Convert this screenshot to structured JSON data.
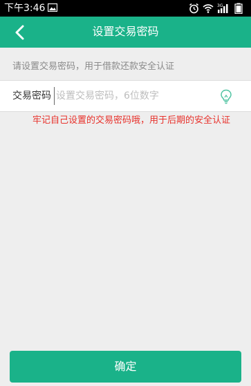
{
  "status_bar": {
    "time": "下午3:46",
    "icons": [
      "image-icon",
      "alarm-icon",
      "wifi-icon",
      "signal-icon",
      "battery-icon"
    ]
  },
  "app_bar": {
    "title": "设置交易密码",
    "back_icon": "back-arrow-icon"
  },
  "form": {
    "hint": "请设置交易密码，用于借款还款安全认证",
    "password_label": "交易密码",
    "password_placeholder": "设置交易密码，6位数字",
    "password_value": "",
    "toggle_icon": "lightbulb-icon",
    "warning": "牢记自己设置的交易密码哦，用于后期的安全认证"
  },
  "confirm_button": {
    "label": "确定"
  },
  "colors": {
    "primary": "#1ab289",
    "warning": "#e8312b",
    "background": "#eeeeee"
  }
}
